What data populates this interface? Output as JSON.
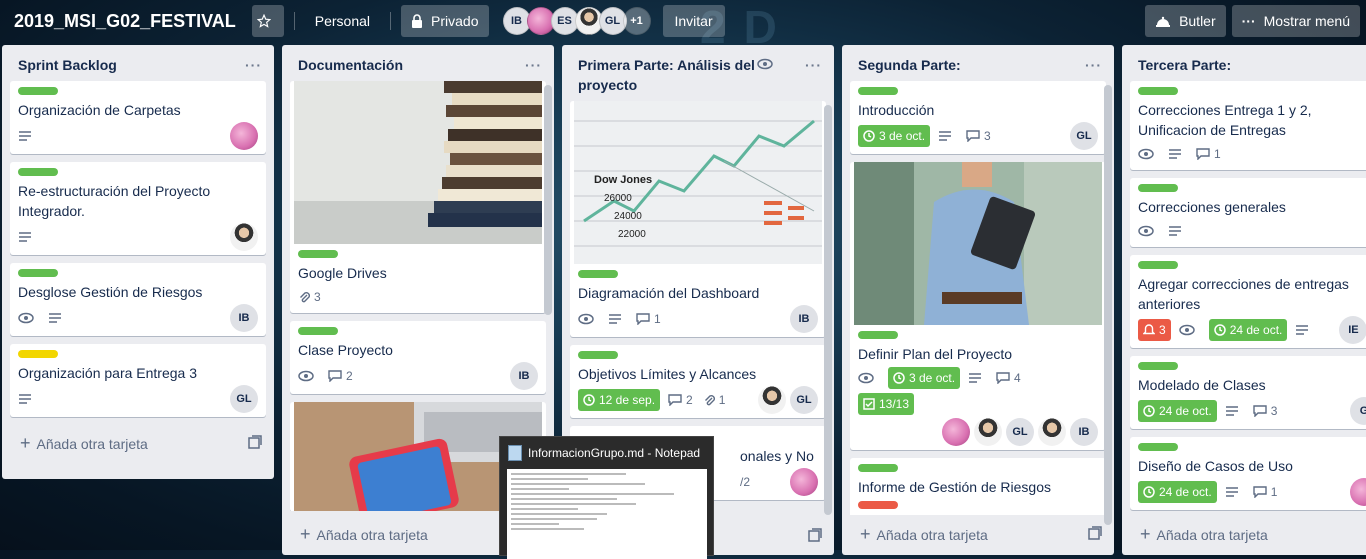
{
  "header": {
    "board_title": "2019_MSI_G02_FESTIVAL",
    "team": "Personal",
    "visibility": "Privado",
    "members": [
      "IB",
      "",
      "ES",
      "",
      "GL"
    ],
    "more_members": "+1",
    "invite": "Invitar",
    "butler": "Butler",
    "menu": "Mostrar menú"
  },
  "colors": {
    "green": "#61bd4f",
    "yellow": "#f2d600",
    "red": "#eb5a46"
  },
  "lists": [
    {
      "title": "Sprint Backlog",
      "add": "Añada otra tarjeta",
      "cards": [
        {
          "title": "Organización de Carpetas"
        },
        {
          "title": "Re-estructuración del Proyecto Integrador."
        },
        {
          "title": "Desglose Gestión de Riesgos",
          "member": "IB"
        },
        {
          "title": "Organización para Entrega 3",
          "member": "GL"
        }
      ]
    },
    {
      "title": "Documentación",
      "add": "Añada otra tarjeta",
      "cards": [
        {
          "title": "Google Drives",
          "attachments": "3"
        },
        {
          "title": "Clase Proyecto",
          "comments": "2",
          "member": "IB"
        }
      ]
    },
    {
      "title": "Primera Parte: Análisis del proyecto",
      "cards": [
        {
          "title": "Diagramación del Dashboard",
          "comments": "1",
          "member": "IB"
        },
        {
          "title": "Objetivos Límites y Alcances",
          "due": "12 de sep.",
          "comments": "2",
          "attachments": "1",
          "member": "GL"
        },
        {
          "title": "onales y No",
          "checklist": "/2"
        }
      ],
      "cover_text": [
        "Dow Jones",
        "26000",
        "24000",
        "22000"
      ]
    },
    {
      "title": "Segunda Parte:",
      "add": "Añada otra tarjeta",
      "cards": [
        {
          "title": "Introducción",
          "due": "3 de oct.",
          "comments": "3",
          "member": "GL"
        },
        {
          "title": "Definir Plan del Proyecto",
          "due": "3 de oct.",
          "comments": "4",
          "checklist": "13/13",
          "members": [
            "GL",
            "IB"
          ]
        },
        {
          "title": "Informe de Gestión de Riesgos"
        }
      ]
    },
    {
      "title": "Tercera Parte:",
      "add": "Añada otra tarjeta",
      "cards": [
        {
          "title": "Correcciones Entrega 1 y 2, Unificacion de Entregas",
          "comments": "1"
        },
        {
          "title": "Correcciones generales"
        },
        {
          "title": "Agregar correcciones de entregas anteriores",
          "notifications": "3",
          "due": "24 de oct.",
          "member": "IE"
        },
        {
          "title": "Modelado de Clases",
          "due": "24 de oct.",
          "comments": "3",
          "member": "G"
        },
        {
          "title": "Diseño de Casos de Uso",
          "due": "24 de oct.",
          "comments": "1"
        }
      ]
    }
  ],
  "notepad": {
    "title": "InformacionGrupo.md - Notepad"
  }
}
